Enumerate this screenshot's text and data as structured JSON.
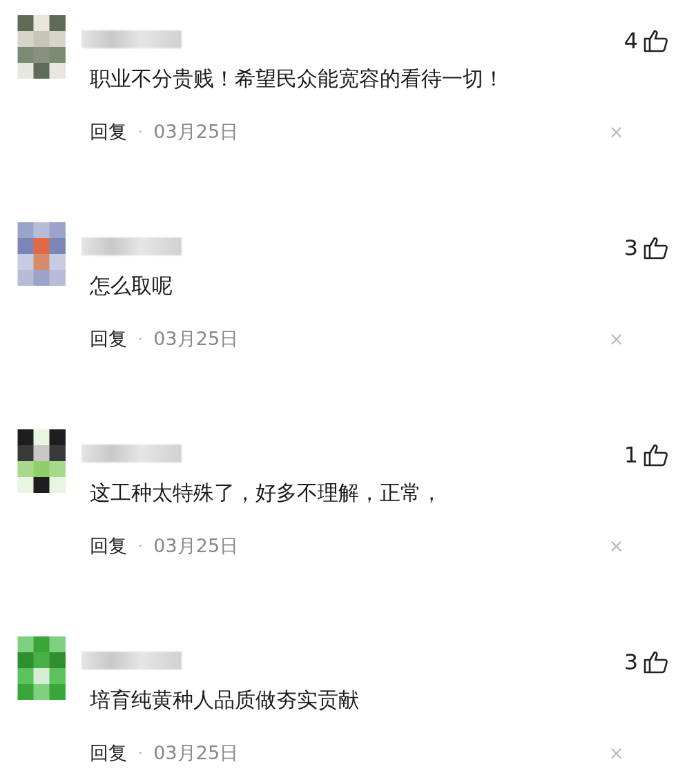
{
  "comments": [
    {
      "likes": "4",
      "text": "职业不分贵贱！希望民众能宽容的看待一切！",
      "reply": "回复",
      "separator": "·",
      "date": "03月25日",
      "dismiss": "×"
    },
    {
      "likes": "3",
      "text": "怎么取呢",
      "reply": "回复",
      "separator": "·",
      "date": "03月25日",
      "dismiss": "×"
    },
    {
      "likes": "1",
      "text": "这工种太特殊了，好多不理解，正常，",
      "reply": "回复",
      "separator": "·",
      "date": "03月25日",
      "dismiss": "×"
    },
    {
      "likes": "3",
      "text": "培育纯黄种人品质做夯实贡献",
      "reply": "回复",
      "separator": "·",
      "date": "03月25日",
      "dismiss": "×"
    }
  ]
}
